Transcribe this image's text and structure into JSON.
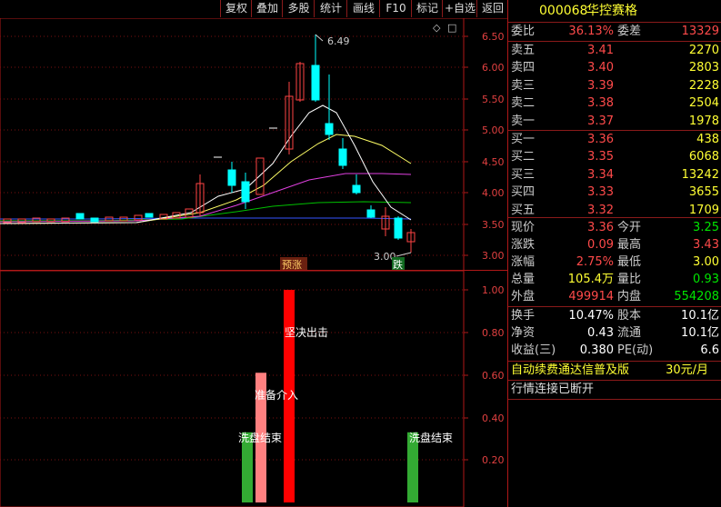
{
  "toolbar": {
    "items": [
      "复权",
      "叠加",
      "多股",
      "统计",
      "画线",
      "F10",
      "标记",
      "+自选",
      "返回"
    ]
  },
  "main_chart": {
    "price_axis": [
      "6.50",
      "6.00",
      "5.50",
      "5.00",
      "4.50",
      "4.00",
      "3.50",
      "3.00"
    ],
    "high_label": "6.49",
    "low_label": "3.00",
    "tag_pre_rise": "预涨",
    "tag_fall": "跌",
    "diamond_icon": "◇",
    "square_icon": "□"
  },
  "indicator_chart": {
    "axis": [
      "1.00",
      "0.80",
      "0.60",
      "0.40",
      "0.20"
    ],
    "labels": {
      "washout1": "洗盘结束",
      "prepare": "准备介入",
      "decisive": "坚决出击",
      "washout2": "洗盘结束"
    },
    "bars": [
      {
        "name": "washout-bar-1",
        "value": 0.33,
        "color": "#33aa33"
      },
      {
        "name": "prepare-bar",
        "value": 0.61,
        "color": "#ff8080"
      },
      {
        "name": "decisive-bar",
        "value": 1.0,
        "color": "#ff0000"
      },
      {
        "name": "washout-bar-2",
        "value": 0.33,
        "color": "#33aa33"
      }
    ]
  },
  "quote": {
    "code": "000068",
    "name": "华控赛格",
    "weibi_label": "委比",
    "weibi": "36.13%",
    "weicha_label": "委差",
    "weicha": "13329",
    "asks": [
      {
        "label": "卖五",
        "price": "3.41",
        "vol": "2270"
      },
      {
        "label": "卖四",
        "price": "3.40",
        "vol": "2803"
      },
      {
        "label": "卖三",
        "price": "3.39",
        "vol": "2228"
      },
      {
        "label": "卖二",
        "price": "3.38",
        "vol": "2504"
      },
      {
        "label": "卖一",
        "price": "3.37",
        "vol": "1978"
      }
    ],
    "bids": [
      {
        "label": "买一",
        "price": "3.36",
        "vol": "438"
      },
      {
        "label": "买二",
        "price": "3.35",
        "vol": "6068"
      },
      {
        "label": "买三",
        "price": "3.34",
        "vol": "13242"
      },
      {
        "label": "买四",
        "price": "3.33",
        "vol": "3655"
      },
      {
        "label": "买五",
        "price": "3.32",
        "vol": "1709"
      }
    ],
    "stats": {
      "xianjia_label": "现价",
      "xianjia": "3.36",
      "jinkai_label": "今开",
      "jinkai": "3.25",
      "zhangdie_label": "涨跌",
      "zhangdie": "0.09",
      "zuigao_label": "最高",
      "zuigao": "3.43",
      "zhangfu_label": "涨幅",
      "zhangfu": "2.75%",
      "zuidi_label": "最低",
      "zuidi": "3.00",
      "zongliang_label": "总量",
      "zongliang": "105.4万",
      "liangbi_label": "量比",
      "liangbi": "0.93",
      "waipan_label": "外盘",
      "waipan": "499914",
      "neipan_label": "内盘",
      "neipan": "554208",
      "huanshou_label": "换手",
      "huanshou": "10.47%",
      "guben_label": "股本",
      "guben": "10.1亿",
      "jingzi_label": "净资",
      "jingzi": "0.43",
      "liutong_label": "流通",
      "liutong": "10.1亿",
      "shouyi_label": "收益(三)",
      "shouyi": "0.380",
      "pe_label": "PE(动)",
      "pe": "6.6"
    },
    "ad_text": "自动续费通达信普及版",
    "ad_price": "30元/月",
    "status_text": "行情连接已断开"
  }
}
